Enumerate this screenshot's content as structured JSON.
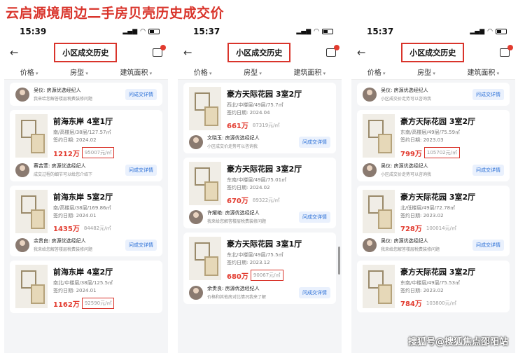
{
  "headline": "云启源境周边二手房贝壳历史成交价",
  "watermark": "搜狐号@搜狐焦点邵阳站",
  "screens": [
    {
      "time": "15:39",
      "title": "小区成交历史",
      "filters": [
        "价格",
        "房型",
        "建筑面积"
      ],
      "top_agent": {
        "name": "吴仪: 房源优选经纪人",
        "note": "我来给您解答楼层税费装修问题",
        "button": "问成交详情"
      },
      "listings": [
        {
          "name": "前海东岸 4室1厅",
          "detail": "南/高楼层/38层/127.57㎡",
          "date": "签约日期: 2024.02",
          "total": "1212万",
          "unit": "95007元/㎡",
          "boxed": true,
          "agent": {
            "name": "蔡苦萱: 房源优选经纪人",
            "note": "成交过程的细节可以给您介绍下",
            "button": "问成交详情"
          }
        },
        {
          "name": "前海东岸 5室2厅",
          "detail": "南/高楼层/38层/169.86㎡",
          "date": "签约日期: 2024.01",
          "total": "1435万",
          "unit": "84482元/㎡",
          "boxed": false,
          "agent": {
            "name": "余贵良: 房源优选经纪人",
            "note": "我来给您解答楼层税费装修问题",
            "button": "问成交详情"
          }
        },
        {
          "name": "前海东岸 4室2厅",
          "detail": "南北/中楼层/38层/125.5㎡",
          "date": "签约日期: 2024.01",
          "total": "1162万",
          "unit": "92590元/㎡",
          "boxed": true
        }
      ]
    },
    {
      "time": "15:37",
      "title": "小区成交历史",
      "filters": [
        "价格",
        "房型",
        "建筑面积"
      ],
      "listings": [
        {
          "name": "豪方天际花园 3室2厅",
          "detail": "西北/中楼层/49层/75.7㎡",
          "date": "签约日期: 2024.04",
          "total": "661万",
          "unit": "87319元/㎡",
          "boxed": false,
          "agent": {
            "name": "文晓玉: 房源优选经纪人",
            "note": "小区成交价走势可以咨询我",
            "button": "问成交详情"
          }
        },
        {
          "name": "豪方天际花园 3室2厅",
          "detail": "东南/中楼层/49层/75.01㎡",
          "date": "签约日期: 2024.02",
          "total": "670万",
          "unit": "89322元/㎡",
          "boxed": false,
          "agent": {
            "name": "许耀艳: 房源优选经纪人",
            "note": "我来给您解答楼层税费装修问题",
            "button": "问成交详情"
          }
        },
        {
          "name": "豪方天际花园 3室1厅",
          "detail": "东北/中楼层/49层/75.5㎡",
          "date": "签约日期: 2023.12",
          "total": "680万",
          "unit": "90067元/㎡",
          "boxed": true,
          "agent": {
            "name": "余贵良: 房源优选经纪人",
            "note": "价格和其他房对比情况我来了解",
            "button": "问成交详情"
          }
        }
      ]
    },
    {
      "time": "15:37",
      "title": "小区成交历史",
      "filters": [
        "价格",
        "房型",
        "建筑面积"
      ],
      "top_agent": {
        "name": "吴仪: 房源优选经纪人",
        "note": "小区成交价走势可以咨询我",
        "button": "问成交详情"
      },
      "listings": [
        {
          "name": "豪方天际花园 3室2厅",
          "detail": "东南/高楼层/49层/75.59㎡",
          "date": "签约日期: 2023.03",
          "total": "799万",
          "unit": "105702元/㎡",
          "boxed": true,
          "agent": {
            "name": "吴仪: 房源优选经纪人",
            "note": "小区成交价走势可以咨询我",
            "button": "问成交详情"
          }
        },
        {
          "name": "豪方天际花园 3室2厅",
          "detail": "北/低楼层/49层/72.78㎡",
          "date": "签约日期: 2023.02",
          "total": "728万",
          "unit": "100014元/㎡",
          "boxed": false,
          "agent": {
            "name": "吴仪: 房源优选经纪人",
            "note": "我来给您解答楼层税费装修问题",
            "button": "问成交详情"
          }
        },
        {
          "name": "豪方天际花园 3室2厅",
          "detail": "东南/中楼层/49层/75.53㎡",
          "date": "签约日期: 2023.02",
          "total": "784万",
          "unit": "103800元/㎡",
          "boxed": false
        }
      ]
    }
  ]
}
